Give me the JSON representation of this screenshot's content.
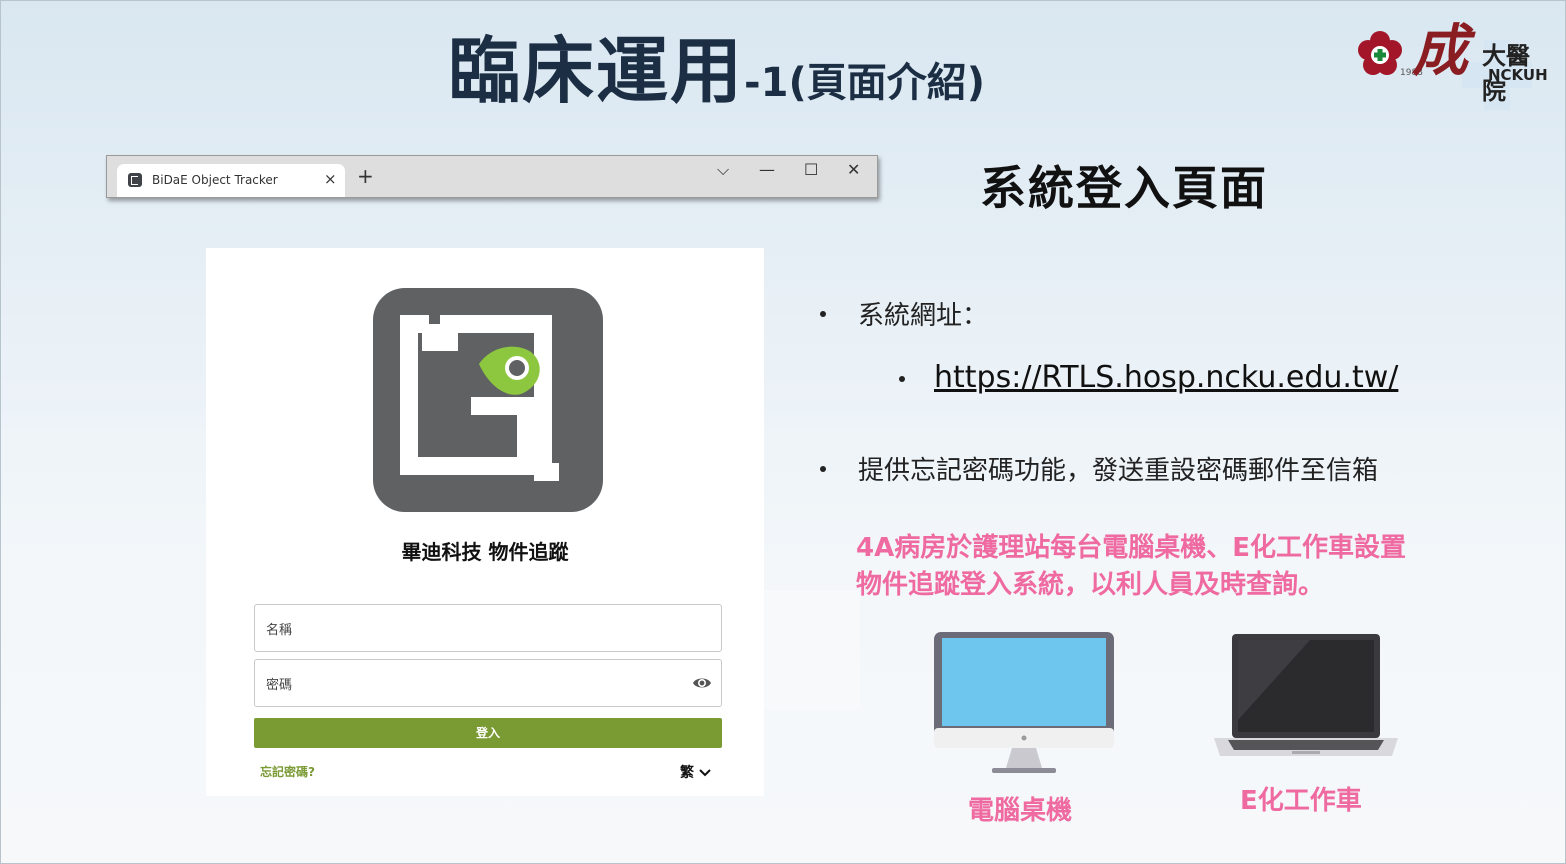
{
  "slide": {
    "title_main": "臨床運用",
    "title_sub": "-1(頁面介紹)",
    "subtitle": "系統登入頁面",
    "logo": {
      "glyph": "成",
      "hospital": "大醫院",
      "abbr": "NCKUH",
      "year": "1988"
    }
  },
  "browser": {
    "tab_title": "BiDaE Object Tracker",
    "tab_close": "×",
    "new_tab": "+",
    "controls": {
      "dropdown": "⌵",
      "minimize": "—",
      "maximize": "☐",
      "close": "✕"
    }
  },
  "login_page": {
    "brand": "畢迪科技 物件追蹤",
    "username_placeholder": "名稱",
    "password_placeholder": "密碼",
    "login_button": "登入",
    "forgot_password": "忘記密碼?",
    "language": "繁"
  },
  "bullets": {
    "url_label": "系統網址：",
    "url": "https://RTLS.hosp.ncku.edu.tw/",
    "feature": "提供忘記密碼功能，發送重設密碼郵件至信箱"
  },
  "note": {
    "line1": "4A病房於護理站每台電腦桌機、E化工作車設置",
    "line2": "物件追蹤登入系統，以利人員及時查詢。"
  },
  "devices": {
    "desktop_label": "電腦桌機",
    "laptop_label": "E化工作車"
  },
  "colors": {
    "accent_green": "#7a9a34",
    "pink": "#ef6aa0",
    "title": "#1b2e44",
    "logo_gray": "#5f6163",
    "logo_green": "#8dc63f"
  }
}
